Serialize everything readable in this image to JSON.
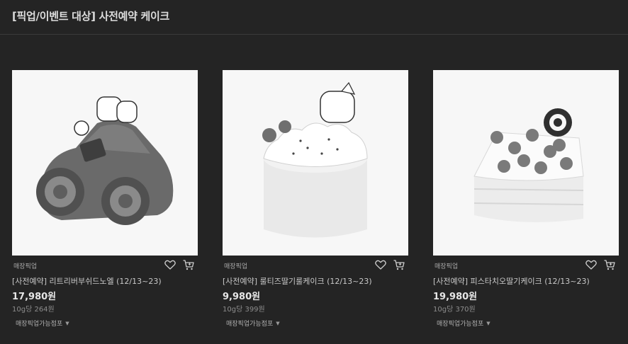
{
  "header": {
    "title": "[픽업/이벤트 대상] 사전예약 케이크"
  },
  "products": [
    {
      "image_desc": "cake-roll-car-image",
      "tag": "매장픽업",
      "name": "[사전예약] 리트리버부쉬드노엘 (12/13~23)",
      "price": "17,980원",
      "unit_price": "10g당 264원",
      "stores_label": "매장픽업가능점포"
    },
    {
      "image_desc": "whipped-cream-cake-image",
      "tag": "매장픽업",
      "name": "[사전예약] 룰티즈딸기룰케이크 (12/13~23)",
      "price": "9,980원",
      "unit_price": "10g당 399원",
      "stores_label": "매장픽업가능점포"
    },
    {
      "image_desc": "strawberry-square-cake-image",
      "tag": "매장픽업",
      "name": "[사전예약] 피스타치오딸기케이크 (12/13~23)",
      "price": "19,980원",
      "unit_price": "10g당 370원",
      "stores_label": "매장픽업가능점포"
    }
  ]
}
